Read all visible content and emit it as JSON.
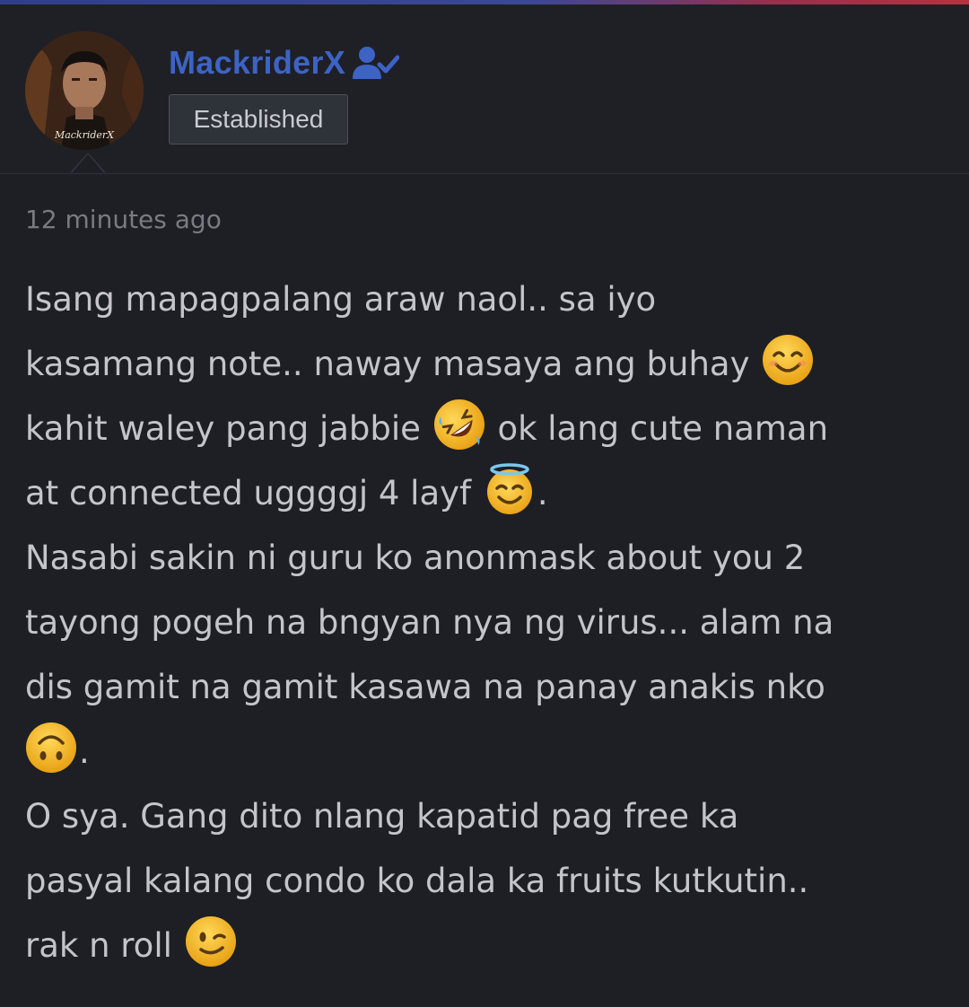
{
  "post": {
    "author": {
      "username": "MackriderX",
      "role_badge": "Established",
      "avatar_caption": "MackriderX"
    },
    "timestamp": "12 minutes ago",
    "body": {
      "line1": "Isang mapagpalang araw naol.. sa iyo",
      "line2": "kasamang note.. naway masaya ang buhay",
      "line3a": "kahit waley pang jabbie",
      "line3b": "ok lang cute naman",
      "line4a": "at connected uggggj 4 layf",
      "line4b": ".",
      "line5": "Nasabi sakin ni guru ko anonmask about you 2",
      "line6": "tayong pogeh na bngyan nya ng virus... alam na",
      "line7": "dis gamit na gamit kasawa na panay anakis nko",
      "line8": ".",
      "line9": "O sya. Gang dito nlang kapatid pag free ka",
      "line10": "pasyal kalang condo ko dala ka fruits kutkutin..",
      "line11": "rak n roll"
    }
  },
  "icons": {
    "verified": "user-check-icon",
    "emoji_1": "smiling-face-with-smiling-eyes",
    "emoji_2": "rolling-on-floor-laughing",
    "emoji_3": "smiling-face-with-halo",
    "emoji_4": "upside-down-face",
    "emoji_5": "winking-face"
  },
  "colors": {
    "background": "#1e1f25",
    "username": "#3d63c4",
    "text": "#c4c4ca",
    "muted": "#7a7b82",
    "badge_bg": "#2e3239"
  }
}
